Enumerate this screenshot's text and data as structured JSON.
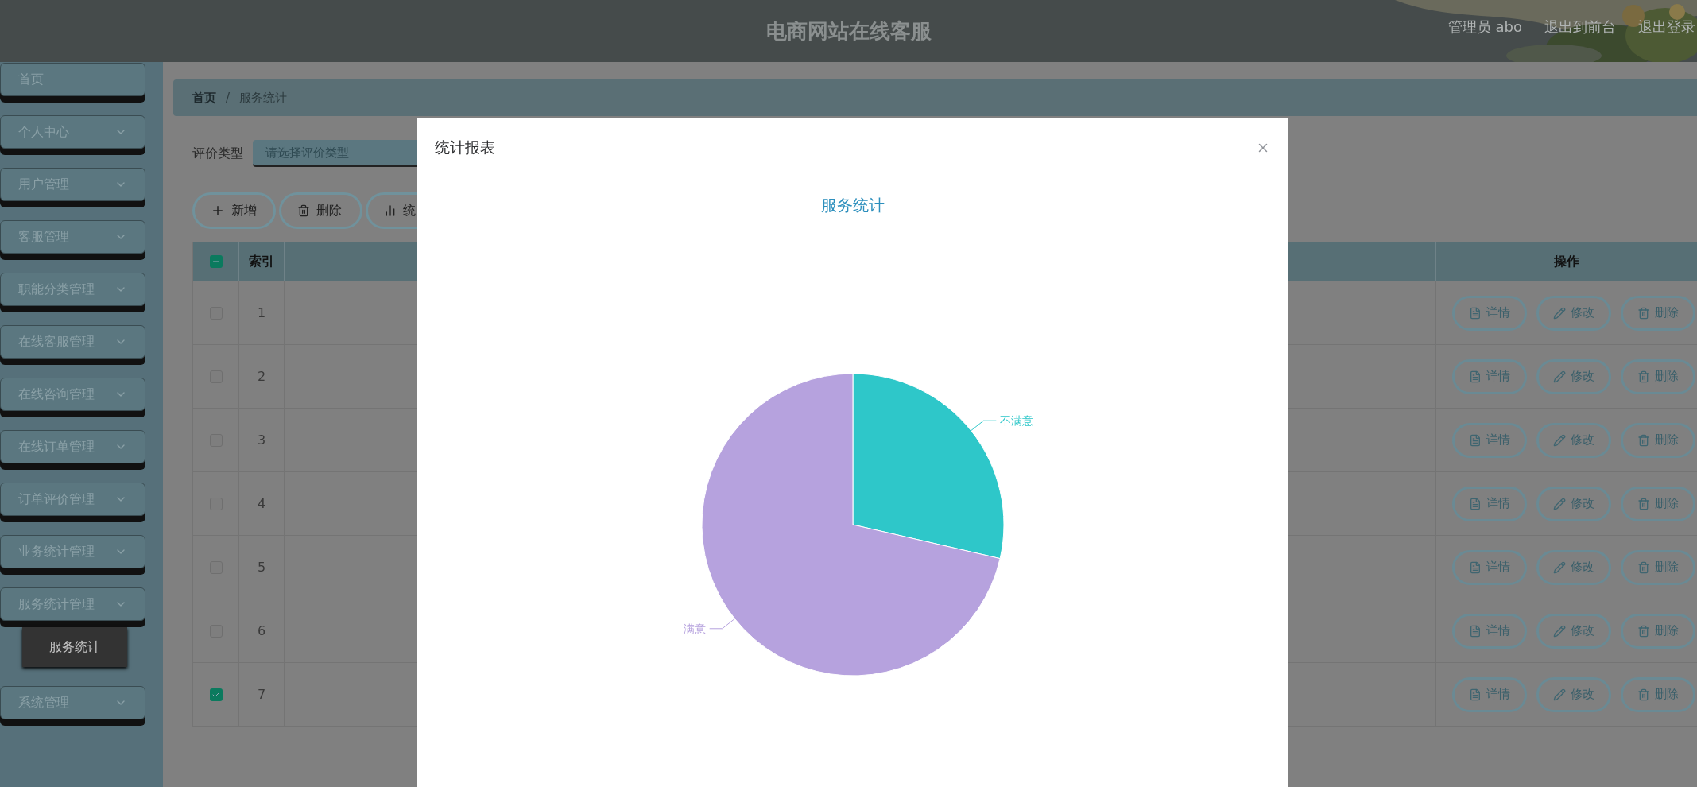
{
  "header": {
    "title": "电商网站在线客服",
    "user": "管理员 abo",
    "links": [
      "退出到前台",
      "退出登录"
    ]
  },
  "sidebar": {
    "items": [
      {
        "label": "首页",
        "kind": "link"
      },
      {
        "label": "个人中心",
        "kind": "menu"
      },
      {
        "label": "用户管理",
        "kind": "menu"
      },
      {
        "label": "客服管理",
        "kind": "menu"
      },
      {
        "label": "职能分类管理",
        "kind": "menu"
      },
      {
        "label": "在线客服管理",
        "kind": "menu"
      },
      {
        "label": "在线咨询管理",
        "kind": "menu"
      },
      {
        "label": "在线订单管理",
        "kind": "menu"
      },
      {
        "label": "订单评价管理",
        "kind": "menu"
      },
      {
        "label": "业务统计管理",
        "kind": "menu"
      },
      {
        "label": "服务统计管理",
        "kind": "menu",
        "children": [
          {
            "label": "服务统计",
            "selected": true
          }
        ]
      },
      {
        "label": "系统管理",
        "kind": "menu"
      }
    ]
  },
  "breadcrumb": {
    "items": [
      "首页",
      "服务统计"
    ],
    "separator": "/"
  },
  "filter": {
    "label": "评价类型",
    "placeholder": "请选择评价类型"
  },
  "toolbar": [
    {
      "label": "新增",
      "kind": "add"
    },
    {
      "label": "删除",
      "kind": "delete"
    },
    {
      "label": "统",
      "kind": "chart"
    }
  ],
  "table": {
    "select_all_indeterminate": true,
    "columns": [
      "索引",
      "操作"
    ],
    "rows": [
      {
        "index": "1",
        "checked": false,
        "actions": [
          "详情",
          "修改",
          "删除"
        ]
      },
      {
        "index": "2",
        "checked": false,
        "actions": [
          "详情",
          "修改",
          "删除"
        ]
      },
      {
        "index": "3",
        "checked": false,
        "actions": [
          "详情",
          "修改",
          "删除"
        ]
      },
      {
        "index": "4",
        "checked": false,
        "actions": [
          "详情",
          "修改",
          "删除"
        ]
      },
      {
        "index": "5",
        "checked": false,
        "actions": [
          "详情",
          "修改",
          "删除"
        ]
      },
      {
        "index": "6",
        "checked": false,
        "actions": [
          "详情",
          "修改",
          "删除"
        ]
      },
      {
        "index": "7",
        "checked": true,
        "actions": [
          "详情",
          "修改",
          "删除"
        ]
      }
    ]
  },
  "modal": {
    "title": "统计报表",
    "chart_data": {
      "type": "pie",
      "title": "服务统计",
      "categories": [
        "不满意",
        "满意"
      ],
      "values": [
        28.6,
        71.4
      ]
    }
  }
}
